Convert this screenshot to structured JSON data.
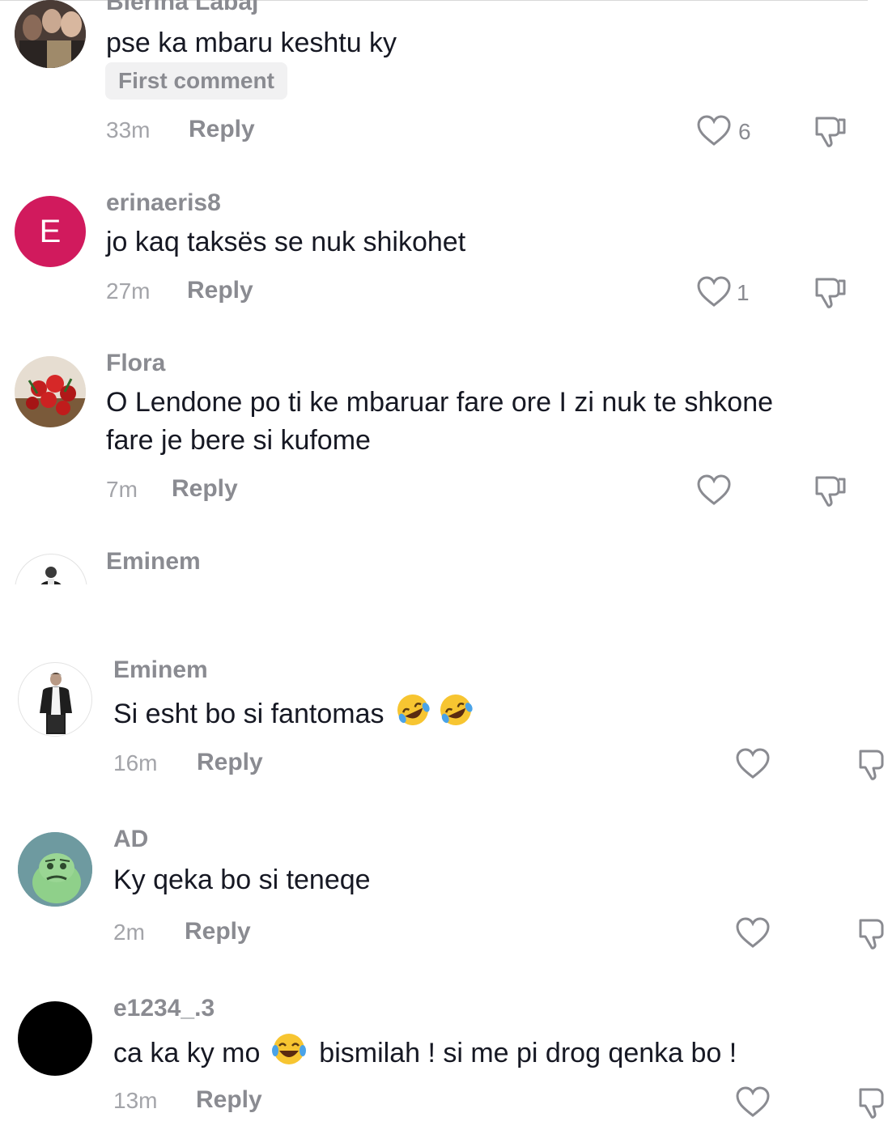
{
  "comments": [
    {
      "username": "Blerina Labaj",
      "text": "pse ka mbaru keshtu ky",
      "badge": "First comment",
      "time": "33m",
      "reply": "Reply",
      "likes": "6"
    },
    {
      "username": "erinaeris8",
      "avatar_letter": "E",
      "avatar_color": "#d11a5d",
      "text": "jo kaq taksës se nuk shikohet",
      "time": "27m",
      "reply": "Reply",
      "likes": "1"
    },
    {
      "username": "Flora",
      "text_line1": "O Lendone po ti ke mbaruar fare ore I zi nuk te shkone",
      "text_line2": "fare je bere si kufome",
      "time": "7m",
      "reply": "Reply"
    },
    {
      "username": "Eminem"
    },
    {
      "username": "Eminem",
      "text": "Si esht bo si fantomas",
      "emoji": [
        "rolling-on-floor-laughing",
        "rolling-on-floor-laughing"
      ],
      "time": "16m",
      "reply": "Reply"
    },
    {
      "username": "AD",
      "text": "Ky qeka bo si teneqe",
      "time": "2m",
      "reply": "Reply"
    },
    {
      "username": "e1234_.3",
      "text_before": "ca ka ky mo",
      "emoji": "face-with-tears-of-joy",
      "text_after": "bismilah ! si me pi drog qenka bo !",
      "time": "13m",
      "reply": "Reply"
    }
  ],
  "colors": {
    "username": "#8a8b91",
    "meta": "#a3a4a9",
    "text": "#161823",
    "badge_bg": "#f1f1f2"
  }
}
